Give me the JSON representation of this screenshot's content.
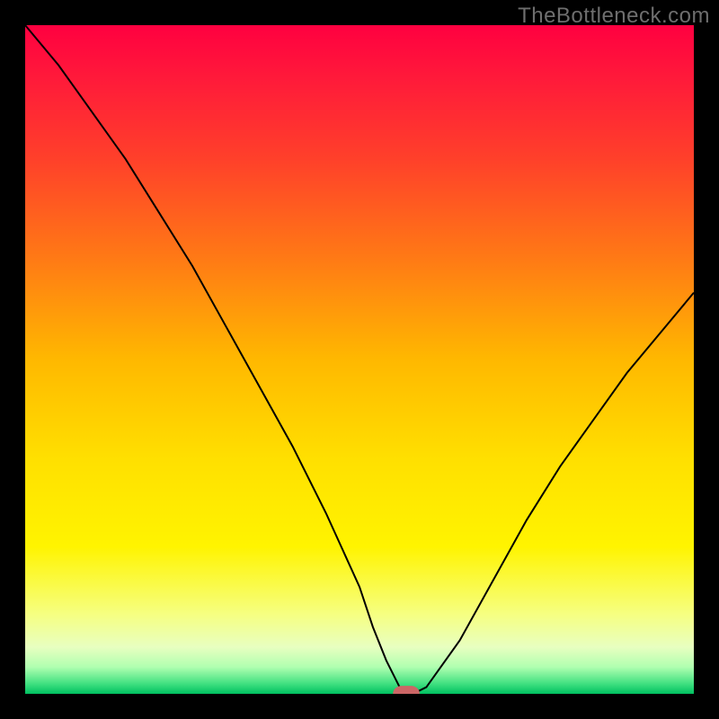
{
  "watermark": "TheBottleneck.com",
  "chart_data": {
    "type": "line",
    "title": "",
    "xlabel": "",
    "ylabel": "",
    "xlim": [
      0,
      100
    ],
    "ylim": [
      0,
      100
    ],
    "grid": false,
    "legend": false,
    "series": [
      {
        "name": "bottleneck-curve",
        "x": [
          0,
          5,
          10,
          15,
          20,
          25,
          30,
          35,
          40,
          45,
          50,
          52,
          54,
          56,
          58,
          60,
          65,
          70,
          75,
          80,
          85,
          90,
          95,
          100
        ],
        "values": [
          100,
          94,
          87,
          80,
          72,
          64,
          55,
          46,
          37,
          27,
          16,
          10,
          5,
          1,
          0,
          1,
          8,
          17,
          26,
          34,
          41,
          48,
          54,
          60
        ]
      }
    ],
    "marker": {
      "x": 57,
      "y": 0,
      "shape": "rounded-rect",
      "color": "#cc6666"
    },
    "background_gradient": {
      "stops": [
        {
          "pos": 0.0,
          "color": "#ff0040"
        },
        {
          "pos": 0.08,
          "color": "#ff1a3a"
        },
        {
          "pos": 0.2,
          "color": "#ff402a"
        },
        {
          "pos": 0.35,
          "color": "#ff7a15"
        },
        {
          "pos": 0.5,
          "color": "#ffb800"
        },
        {
          "pos": 0.65,
          "color": "#ffe000"
        },
        {
          "pos": 0.78,
          "color": "#fff400"
        },
        {
          "pos": 0.88,
          "color": "#f6ff80"
        },
        {
          "pos": 0.93,
          "color": "#e8ffc0"
        },
        {
          "pos": 0.96,
          "color": "#b0ffb0"
        },
        {
          "pos": 0.985,
          "color": "#40e080"
        },
        {
          "pos": 1.0,
          "color": "#00c060"
        }
      ]
    }
  }
}
